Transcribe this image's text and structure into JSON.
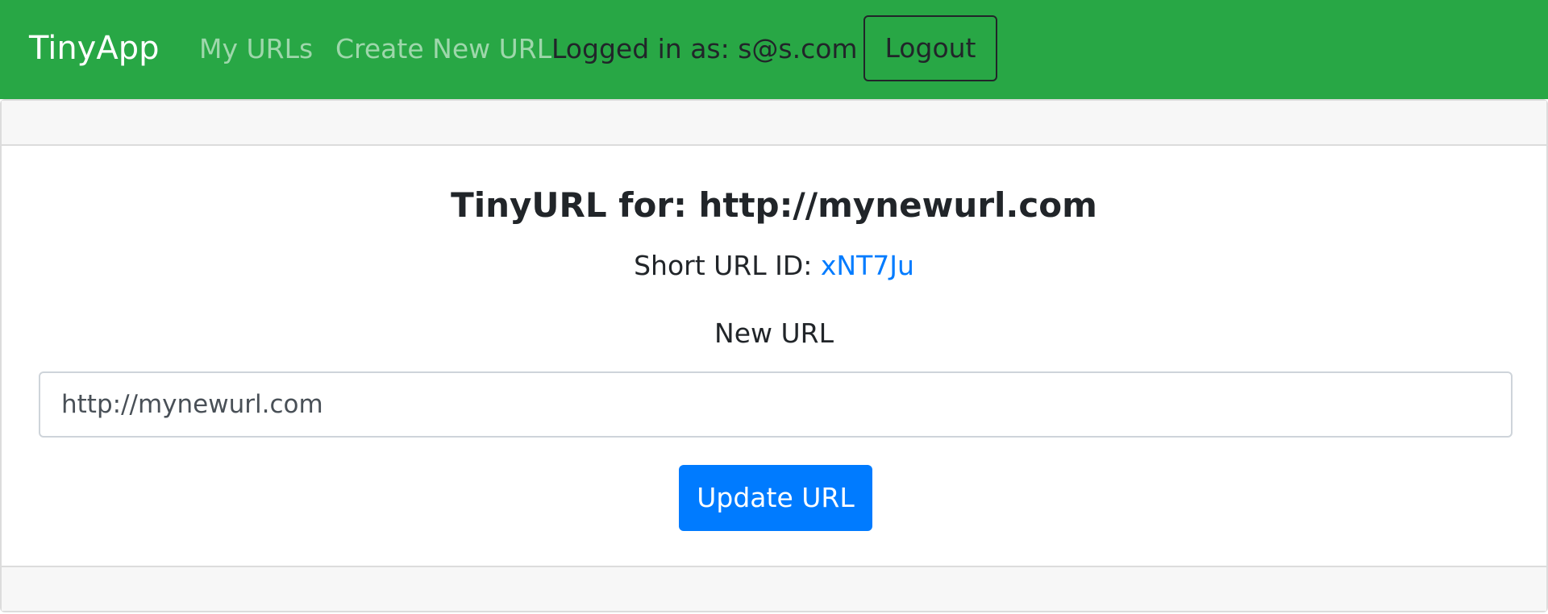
{
  "navbar": {
    "brand": "TinyApp",
    "links": [
      {
        "label": "My URLs"
      },
      {
        "label": "Create New URL"
      }
    ],
    "logged_in_text": "Logged in as: s@s.com",
    "logout_label": "Logout"
  },
  "main": {
    "title": "TinyURL for: http://mynewurl.com",
    "short_url_label": "Short URL ID: ",
    "short_url_id": "xNT7Ju",
    "new_url_label": "New URL",
    "new_url_value": "http://mynewurl.com",
    "update_label": "Update URL"
  },
  "colors": {
    "navbar": "#28a745",
    "primary": "#007bff",
    "card_header": "#f7f7f7"
  }
}
